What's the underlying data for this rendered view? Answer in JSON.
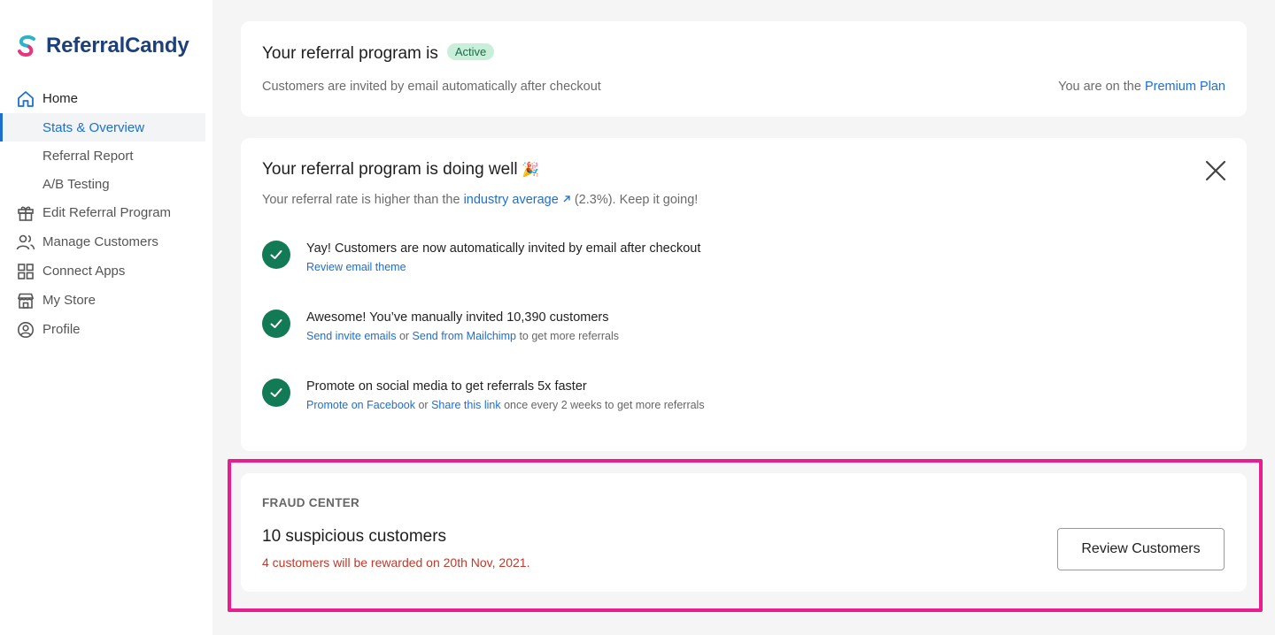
{
  "brand": {
    "name": "ReferralCandy"
  },
  "sidebar": {
    "home": "Home",
    "sub_items": [
      "Stats & Overview",
      "Referral Report",
      "A/B Testing"
    ],
    "items": [
      {
        "label": "Edit Referral Program",
        "icon": "gift-icon"
      },
      {
        "label": "Manage Customers",
        "icon": "users-icon"
      },
      {
        "label": "Connect Apps",
        "icon": "apps-grid-icon"
      },
      {
        "label": "My Store",
        "icon": "store-icon"
      },
      {
        "label": "Profile",
        "icon": "profile-icon"
      }
    ]
  },
  "status_card": {
    "title": "Your referral program is",
    "badge": "Active",
    "subtitle": "Customers are invited by email automatically after checkout",
    "plan_prefix": "You are on the",
    "plan_link": "Premium Plan"
  },
  "progress_card": {
    "title": "Your referral program is doing well",
    "title_emoji": "🎉",
    "sub_prefix": "Your referral rate is higher than the",
    "sub_link": "industry average",
    "sub_suffix": "(2.3%). Keep it going!",
    "tasks": [
      {
        "main": "Yay! Customers are now automatically invited by email after checkout",
        "link1": "Review email theme",
        "or": "",
        "link2": "",
        "suffix": ""
      },
      {
        "main": "Awesome! You’ve manually invited 10,390 customers",
        "link1": "Send invite emails",
        "or": "or",
        "link2": "Send from Mailchimp",
        "suffix": "to get more referrals"
      },
      {
        "main": "Promote on social media to get referrals 5x faster",
        "link1": "Promote on Facebook",
        "or": "or",
        "link2": "Share this link",
        "suffix": "once every 2 weeks to get more referrals"
      }
    ]
  },
  "fraud_card": {
    "label": "FRAUD CENTER",
    "count": "10 suspicious customers",
    "warning": "4 customers will be rewarded on 20th Nov, 2021.",
    "button": "Review Customers"
  },
  "colors": {
    "accent": "#1c6fd1",
    "success": "#127a54",
    "warning": "#c0392b",
    "highlight": "#ea1d8f"
  }
}
